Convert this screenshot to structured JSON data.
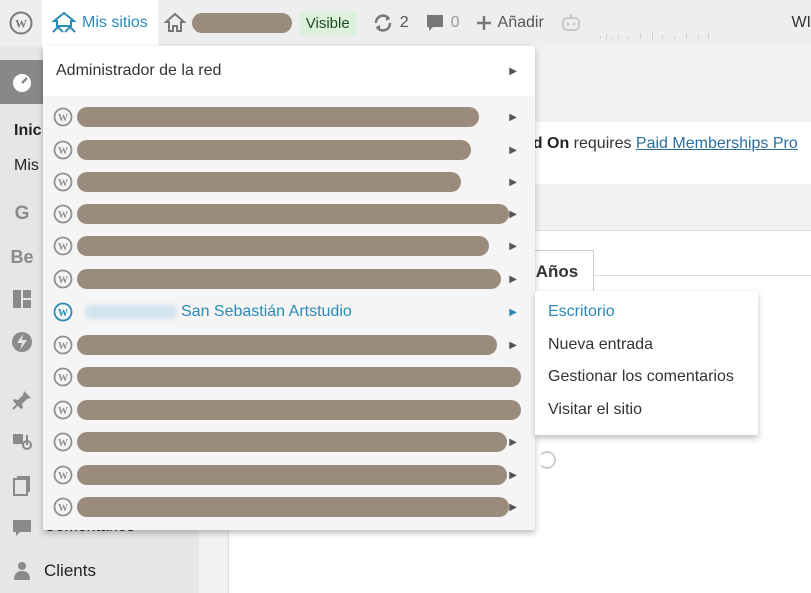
{
  "adminbar": {
    "my_sites_label": "Mis sitios",
    "visible_badge": "Visible",
    "updates_count": "2",
    "comments_count": "0",
    "add_label": "Añadir",
    "user_label": "WI"
  },
  "sidebar": {
    "partial_item_1": "Inic",
    "partial_item_2": "Mis",
    "icon_letters": [
      "G",
      "Be"
    ],
    "comments_partial": "Comentarios",
    "clients_label": "Clients"
  },
  "notice": {
    "bold_part": "dd On",
    "text_part": " requires ",
    "link_text": "Paid Memberships Pro"
  },
  "tabs": {
    "anos_label": "Años"
  },
  "mysites_menu": {
    "network_admin_label": "Administrador de la red",
    "active_site_name": "San Sebastián Artstudio"
  },
  "site_submenu": {
    "items": [
      "Escritorio",
      "Nueva entrada",
      "Gestionar los comentarios",
      "Visitar el sitio"
    ]
  },
  "colors": {
    "accent": "#2a8ab8",
    "blurred": "#9a8b7c",
    "badge_bg": "#dcf1dc"
  }
}
